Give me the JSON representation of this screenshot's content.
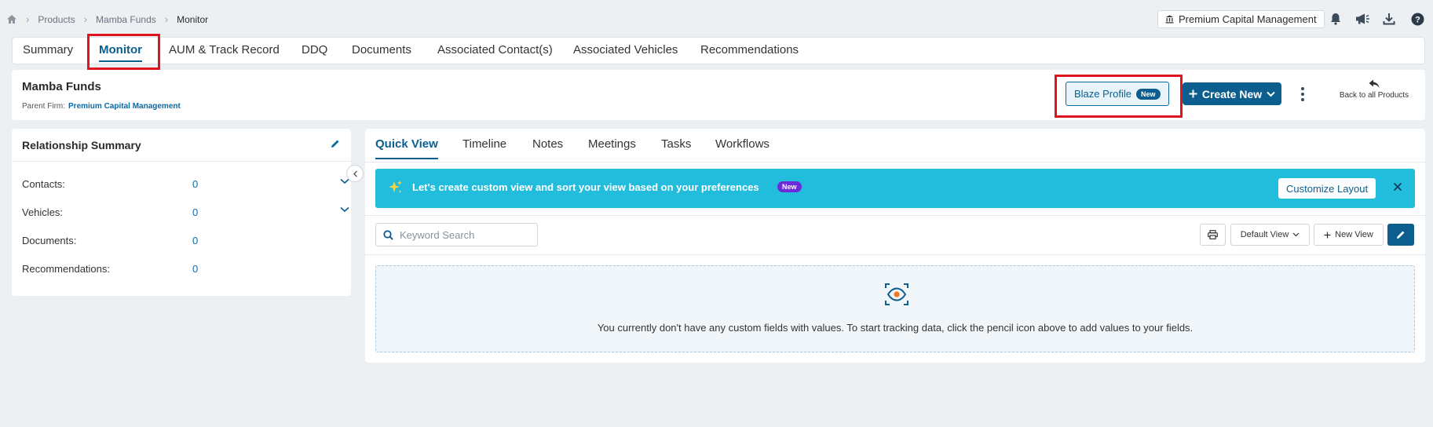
{
  "breadcrumb": {
    "items": [
      "Products",
      "Mamba Funds"
    ],
    "current": "Monitor"
  },
  "topbar": {
    "firm_button": "Premium Capital Management"
  },
  "tabs": [
    "Summary",
    "Monitor",
    "AUM & Track Record",
    "DDQ",
    "Documents",
    "Associated Contact(s)",
    "Associated Vehicles",
    "Recommendations"
  ],
  "active_tab": "Monitor",
  "header": {
    "title": "Mamba Funds",
    "parent_label": "Parent Firm:",
    "parent_value": "Premium Capital Management",
    "blaze_label": "Blaze Profile",
    "blaze_badge": "New",
    "create_label": "Create New",
    "back_label": "Back to all Products"
  },
  "relationship": {
    "title": "Relationship Summary",
    "rows": [
      {
        "label": "Contacts:",
        "value": "0"
      },
      {
        "label": "Vehicles:",
        "value": "0"
      },
      {
        "label": "Documents:",
        "value": "0"
      },
      {
        "label": "Recommendations:",
        "value": "0"
      }
    ]
  },
  "main": {
    "tabs": [
      "Quick View",
      "Timeline",
      "Notes",
      "Meetings",
      "Tasks",
      "Workflows"
    ],
    "banner_text": "Let's create custom view and sort your view based on your preferences",
    "banner_badge": "New",
    "customize_label": "Customize Layout",
    "search_placeholder": "Keyword Search",
    "view_select": "Default View",
    "new_view": "New View",
    "empty_message": "You currently don't have any custom fields with values. To start tracking data, click the pencil icon above to add values to your fields."
  },
  "colors": {
    "primary": "#0b5e8e",
    "banner": "#22bcdc",
    "highlight": "#e0141e",
    "badge_purple": "#6b2bd9"
  },
  "icons": [
    "home-icon",
    "bank-icon",
    "bell-icon",
    "megaphone-icon",
    "download-icon",
    "help-icon",
    "reply-icon",
    "pencil-icon",
    "sparkle-icon",
    "close-icon",
    "search-icon",
    "print-icon",
    "eye-icon",
    "chevron-left-icon"
  ]
}
